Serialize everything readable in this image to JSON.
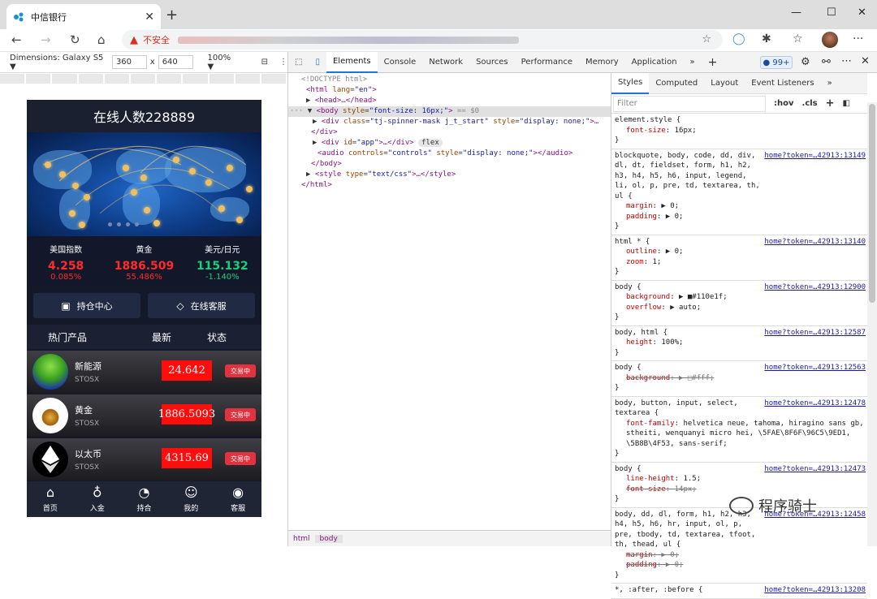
{
  "browser": {
    "tab_title": "中信银行",
    "close_glyph": "✕",
    "new_tab_glyph": "+",
    "insecure_label": "不安全",
    "more_glyph": "···"
  },
  "device_toolbar": {
    "dimensions_label": "Dimensions: Galaxy S5 ▼",
    "width": "360",
    "times": "x",
    "height": "640",
    "zoom": "100% ▼"
  },
  "app": {
    "header_title": "在线人数228889",
    "quotes": [
      {
        "name": "美国指数",
        "price": "4.258",
        "change": "0.085%",
        "color": "red"
      },
      {
        "name": "黄金",
        "price": "1886.509",
        "change": "55.486%",
        "color": "red"
      },
      {
        "name": "美元/日元",
        "price": "115.132",
        "change": "-1.140%",
        "color": "green"
      }
    ],
    "buttons": {
      "positions": "持仓中心",
      "service": "在线客服"
    },
    "product_header": {
      "c1": "热门产品",
      "c2": "最新",
      "c3": "状态"
    },
    "products": [
      {
        "name": "新能源",
        "code": "STOSX",
        "price": "24.642",
        "status": "交易中"
      },
      {
        "name": "黄金",
        "code": "STOSX",
        "price": "1886.5093",
        "status": "交易中"
      },
      {
        "name": "以太币",
        "code": "STOSX",
        "price": "4315.69",
        "status": "交易中"
      }
    ],
    "tabbar": [
      {
        "label": "首页",
        "icon": "home-icon"
      },
      {
        "label": "入金",
        "icon": "money-bag-icon"
      },
      {
        "label": "持合",
        "icon": "chart-icon"
      },
      {
        "label": "我的",
        "icon": "user-icon"
      },
      {
        "label": "客服",
        "icon": "headset-icon"
      }
    ]
  },
  "devtools": {
    "tabs": [
      "Elements",
      "Console",
      "Network",
      "Sources",
      "Performance",
      "Memory",
      "Application"
    ],
    "active_tab": "Elements",
    "issues_badge": "99+",
    "elements": {
      "doctype": "<!DOCTYPE html>",
      "html_open": "<html",
      "html_attr": "lang",
      "html_val": "\"en\"",
      "head": "<head>…</head>",
      "body_open": "<body",
      "body_attr": "style",
      "body_val": "\"font-size: 16px;\"",
      "body_note": "== $0",
      "spinner_open": "<div",
      "spinner_attr1": "class",
      "spinner_val1": "\"tj-spinner-mask j_t_start\"",
      "spinner_attr2": "style",
      "spinner_val2": "\"display: none;\"",
      "spinner_tail": ">…",
      "div_close": "</div>",
      "app_open": "<div",
      "app_attr": "id",
      "app_val": "\"app\"",
      "app_tail": ">…</div>",
      "flex_pill": "flex",
      "audio_open": "<audio",
      "audio_attr1": "controls",
      "audio_val1": "\"controls\"",
      "audio_attr2": "style",
      "audio_val2": "\"display: none;\"",
      "audio_tail": "></audio>",
      "body_close": "</body>",
      "style_open": "<style",
      "style_attr": "type",
      "style_val": "\"text/css\"",
      "style_tail": ">…</style>",
      "html_close": "</html>"
    },
    "breadcrumbs": [
      "html",
      "body"
    ],
    "styles_tabs": [
      "Styles",
      "Computed",
      "Layout",
      "Event Listeners"
    ],
    "filter_placeholder": "Filter",
    "filter_ops": [
      ":hov",
      ".cls"
    ],
    "rules": [
      {
        "selector": "element.style {",
        "src": "",
        "props": [
          {
            "name": "font-size",
            "value": "16px;"
          }
        ]
      },
      {
        "selector": "blockquote, body, code, dd, div, dl, dt, fieldset, form, h1, h2, h3, h4, h5, h6, input, legend, li, ol, p, pre, td, textarea, th, ul {",
        "src": "home?token=…42913:13149",
        "props": [
          {
            "name": "margin",
            "value": "▶ 0;"
          },
          {
            "name": "padding",
            "value": "▶ 0;"
          }
        ]
      },
      {
        "selector": "html * {",
        "src": "home?token=…42913:13140",
        "props": [
          {
            "name": "outline",
            "value": "▶ 0;"
          },
          {
            "name": "zoom",
            "value": "1;"
          }
        ]
      },
      {
        "selector": "body {",
        "src": "home?token=…42913:12900",
        "props": [
          {
            "name": "background",
            "value": "▶ ■#110e1f;"
          },
          {
            "name": "overflow",
            "value": "▶ auto;"
          }
        ]
      },
      {
        "selector": "body, html {",
        "src": "home?token=…42913:12587",
        "props": [
          {
            "name": "height",
            "value": "100%;"
          }
        ]
      },
      {
        "selector": "body {",
        "src": "home?token=…42913:12563",
        "props": [
          {
            "name": "background",
            "value": "▶ □#fff;",
            "strike": true
          }
        ]
      },
      {
        "selector": "body, button, input, select, textarea {",
        "src": "home?token=…42913:12478",
        "props": [
          {
            "name": "font-family",
            "value": "helvetica neue, tahoma, hiragino sans gb, stheiti, wenquanyi micro hei, \\5FAE\\8F6F\\96C5\\9ED1, \\5B8B\\4F53, sans-serif;"
          }
        ]
      },
      {
        "selector": "body {",
        "src": "home?token=…42913:12473",
        "props": [
          {
            "name": "line-height",
            "value": "1.5;"
          },
          {
            "name": "font-size",
            "value": "14px;",
            "strike": true
          }
        ]
      },
      {
        "selector": "body, dd, dl, form, h1, h2, h3, h4, h5, h6, hr, input, ol, p, pre, tbody, td, textarea, tfoot, th, thead, ul {",
        "src": "home?token=…42913:12458",
        "props": [
          {
            "name": "margin",
            "value": "▶ 0;",
            "strike": true
          },
          {
            "name": "padding",
            "value": "▶ 0;",
            "strike": true
          }
        ]
      },
      {
        "selector": "*, :after, :before {",
        "src": "home?token=…42913:13208",
        "props": []
      }
    ],
    "watermark": "程序骑士"
  },
  "colors": {
    "accent": "#1a73e8",
    "up": "#ff2b2b",
    "down": "#17d07a",
    "price_bg": "#ff0d0d"
  }
}
